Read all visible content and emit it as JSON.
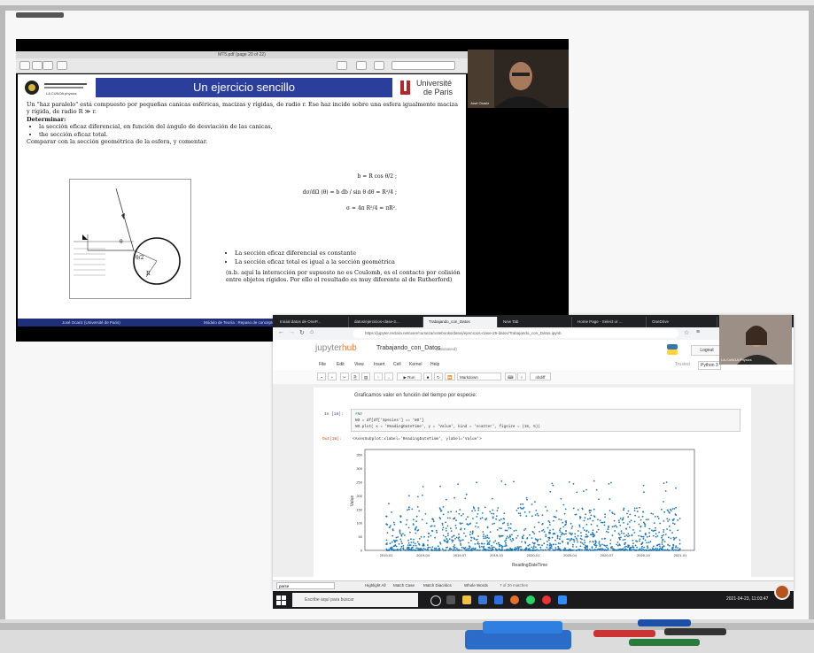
{
  "pdf_viewer": {
    "title": "MT5.pdf (page 20 of 22)",
    "toolbar_left": [
      "View",
      "Zoom",
      "Share"
    ],
    "toolbar_right": [
      "Markup",
      "Rotate",
      "Edit",
      "Search"
    ]
  },
  "slide": {
    "title": "Un ejercicio sencillo",
    "left_logo": "LA CUNOA physics",
    "right_logo_line1": "Université",
    "right_logo_line2": "de Paris",
    "body_line1": "Un \"haz paralelo\" está compuesto por pequeñas canicas esféricas, macizas y rígidas, de radio r. Ese haz incide sobre una esfera igualmente maciza y rígida, de radio R ≫ r.",
    "body_line2": "Determinar:",
    "body_bullets": [
      "la sección eficaz diferencial, en función del ángulo de desviación de las canicas,",
      "the sección eficaz total."
    ],
    "body_line3": "Comparar con la sección geométrica de la esfera, y comentar.",
    "figure_labels": {
      "theta": "θ",
      "half_theta": "θ/2",
      "radius": "R"
    },
    "formula1": "b = R cos θ/2 ;",
    "formula2": "dσ/dΩ (θ) = b db / sin θ dθ = R²/4 ;",
    "formula3": "σ = 4π R²/4 = πR².",
    "result_bullets": [
      "La sección eficaz diferencial es constante",
      "La sección eficaz total es igual a la sección geométrica"
    ],
    "note": "(n.b. aquí la interacción por supuesto no es Coulomb, es el contacto por colisión entre objetos rígidos. Por ello el resultado es muy diferente al de Rutherford)",
    "footer_left": "José Ocariz (Université de Paris)",
    "footer_mid": "Módulo de Teoría : Repaso de conceptos"
  },
  "video1": {
    "name": "José Ocariz"
  },
  "video2": {
    "name": "LA-CoNGA Physics"
  },
  "browser": {
    "tabs": [
      "Inicial datos de OneP...",
      "datos/ejercicios-clase-2...",
      "Trabajando_con_Datos",
      "New Tab",
      "Home Page - Select or ...",
      "OneDrive"
    ],
    "url": "https://jupyter.reclara.net/user/curseza/notebooks/datos/ejercicios-clase-25-datos/Trabajando_con_Datos.ipynb"
  },
  "jupyter": {
    "logo_a": "jupyter",
    "logo_b": "hub",
    "notebook_name": "Trabajando_con_Datos",
    "autosaved": "(autosaved)",
    "logout": "Logout",
    "menu": [
      "File",
      "Edit",
      "View",
      "Insert",
      "Cell",
      "Kernel",
      "Help"
    ],
    "trusted": "Trusted",
    "kernel": "Python 3",
    "toolbar": {
      "run": "Run",
      "cell_type": "Markdown",
      "nbdiff": "nbdiff"
    },
    "markdown_text": "Graficamos valor en función del tiempo por especie:",
    "in_prompt": "In [18]:",
    "code_line1": "#NO",
    "code_line2": "NO = df[df['Species'] == 'NO']",
    "code_line3": "NO.plot( x = 'ReadingDateTime', y = 'Value', kind = 'scatter', figsize = (15, 5))",
    "out_prompt": "Out[18]:",
    "out_text": "<AxesSubplot:xlabel='ReadingDateTime', ylabel='Value'>"
  },
  "chart_data": {
    "type": "scatter",
    "xlabel": "ReadingDateTime",
    "ylabel": "Value",
    "x_ticks": [
      "2019-01",
      "2019-04",
      "2019-07",
      "2019-10",
      "2020-01",
      "2020-04",
      "2020-07",
      "2020-10",
      "2021-01"
    ],
    "y_ticks": [
      0,
      50,
      100,
      150,
      200,
      250,
      300,
      350
    ],
    "ylim": [
      0,
      370
    ],
    "color": "#1f77b4",
    "grid": false
  },
  "findbar": {
    "query": "parse",
    "options": [
      "Highlight All",
      "Match Case",
      "Match Diacritics",
      "Whole Words"
    ],
    "result": "7 of 20 matches"
  },
  "taskbar": {
    "search_placeholder": "Escribe aquí para buscar",
    "datetime": "2021-04-23, 11:03:47"
  }
}
